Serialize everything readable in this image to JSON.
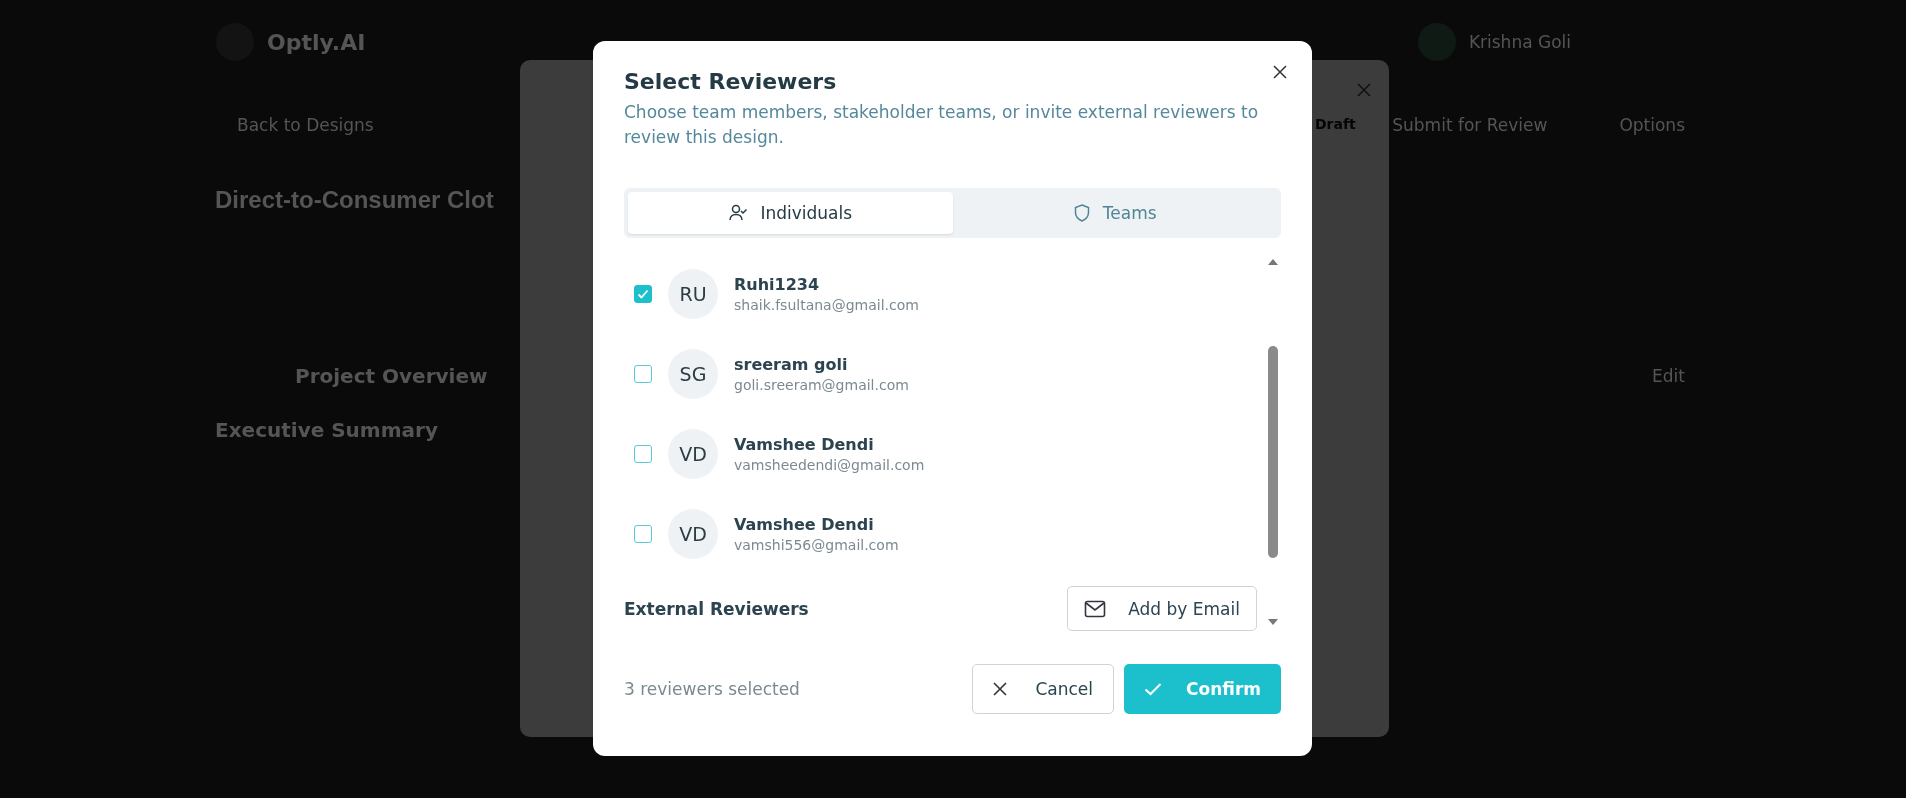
{
  "background": {
    "brand": "Optly.AI",
    "user": "Krishna Goli",
    "back_link": "Back to Designs",
    "page_title": "Direct-to-Consumer Clot",
    "actions": [
      "Submit for Review",
      "Options"
    ],
    "section_title": "Project Overview",
    "edit_button": "Edit",
    "summary_heading": "Executive Summary"
  },
  "back_panel": {
    "status": "Draft"
  },
  "dialog": {
    "title": "Select Reviewers",
    "description": "Choose team members, stakeholder teams, or invite external reviewers to review this design.",
    "tabs": [
      {
        "label": "Individuals",
        "selected": true
      },
      {
        "label": "Teams",
        "selected": false
      }
    ],
    "reviewers": [
      {
        "initials": "RU",
        "name": "Ruhi1234",
        "email": "shaik.fsultana@gmail.com",
        "checked": true
      },
      {
        "initials": "SG",
        "name": "sreeram goli",
        "email": "goli.sreeram@gmail.com",
        "checked": false
      },
      {
        "initials": "VD",
        "name": "Vamshee Dendi",
        "email": "vamsheedendi@gmail.com",
        "checked": false
      },
      {
        "initials": "VD",
        "name": "Vamshee Dendi",
        "email": "vamshi556@gmail.com",
        "checked": false
      }
    ],
    "external_label": "External Reviewers",
    "add_button": "Add by Email",
    "selection_count": "3 reviewers selected",
    "cancel_button": "Cancel",
    "confirm_button": "Confirm"
  }
}
